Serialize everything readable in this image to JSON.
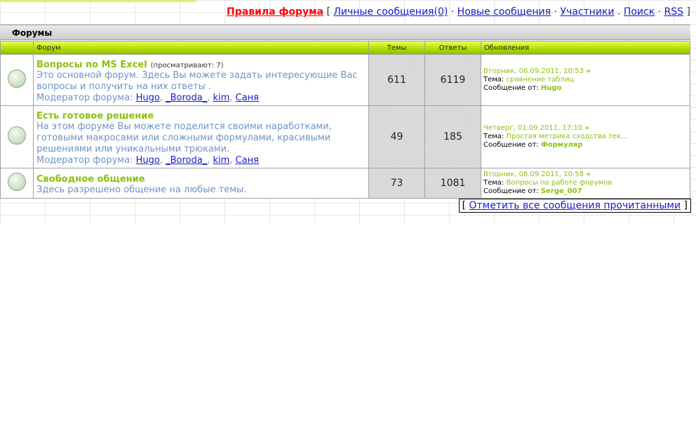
{
  "nav": {
    "rules": "Правила форума",
    "lbracket": "[",
    "pm": "Личные сообщения(0)",
    "dot1": "·",
    "new": "Новые сообщения",
    "dot2": "·",
    "users": "Участники",
    "dot3": ".",
    "search": "Поиск",
    "dot4": "·",
    "rss": "RSS",
    "rbracket": "]"
  },
  "section_title": "Форумы",
  "columns": {
    "forum": "Форум",
    "topics": "Темы",
    "replies": "Ответы",
    "updates": "Обновления"
  },
  "forums": [
    {
      "title": "Вопросы по MS Excel",
      "viewing": "(просматривают: 7)",
      "desc": "Это основной форум. Здесь Вы можете задать интересующие Вас вопросы и получить на них ответы .",
      "mod_label": "Модератор форума:",
      "mods": [
        "Hugo",
        "_Boroda_",
        "kim",
        "Саня"
      ],
      "topics": "611",
      "replies": "6119",
      "upd_date": "Вторник, 06.09.2011, 10:53",
      "upd_topic_label": "Тема:",
      "upd_topic": "сравнение таблиц",
      "upd_from_label": "Сообщение от:",
      "upd_author": "Hugo"
    },
    {
      "title": "Есть готовое решение",
      "viewing": "",
      "desc": "На этом форуме Вы можете поделится своими наработками, готовыми макросами или сложными формулами, красивыми решениями или уникальными трюками.",
      "mod_label": "Модератор форума:",
      "mods": [
        "Hugo",
        "_Boroda_",
        "kim",
        "Саня"
      ],
      "topics": "49",
      "replies": "185",
      "upd_date": "Четверг, 01.09.2011, 17:10",
      "upd_topic_label": "Тема:",
      "upd_topic": "Простая метрика сходства тек...",
      "upd_from_label": "Сообщение от:",
      "upd_author": "Формуляр"
    },
    {
      "title": "Свободное общение",
      "viewing": "",
      "desc": "Здесь разрешено общение на любые темы.",
      "mod_label": "",
      "mods": [],
      "topics": "73",
      "replies": "1081",
      "upd_date": "Вторник, 06.09.2011, 10:58",
      "upd_topic_label": "Тема:",
      "upd_topic": "Вопросы по работе форумов",
      "upd_from_label": "Сообщение от:",
      "upd_author": "Serge_007"
    }
  ],
  "mark_read": {
    "lbracket": "[",
    "label": "Отметить все сообщения прочитанными",
    "rbracket": "]"
  }
}
